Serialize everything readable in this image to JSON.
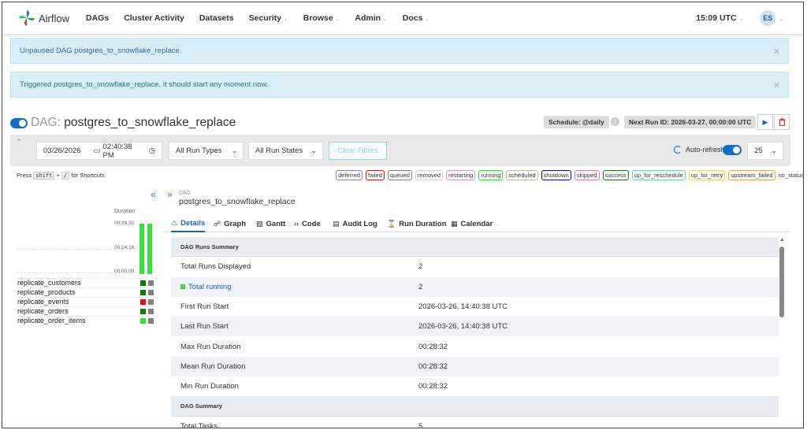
{
  "nav": {
    "brand": "Airflow",
    "items": [
      {
        "label": "DAGs",
        "caret": false
      },
      {
        "label": "Cluster Activity",
        "caret": false
      },
      {
        "label": "Datasets",
        "caret": false
      },
      {
        "label": "Security",
        "caret": true
      },
      {
        "label": "Browse",
        "caret": true
      },
      {
        "label": "Admin",
        "caret": true
      },
      {
        "label": "Docs",
        "caret": true
      }
    ],
    "time": "15:09 UTC",
    "user_initials": "ES"
  },
  "alerts": [
    "Unpaused DAG postgres_to_snowflake_replace.",
    "Triggered postgres_to_snowflake_replace, it should start any moment now."
  ],
  "dag": {
    "prefix": "DAG:",
    "id": "postgres_to_snowflake_replace",
    "schedule": "Schedule: @daily",
    "next_run": "Next Run ID: 2026-03-27, 00:00:00 UTC",
    "breadcrumb": "DAG"
  },
  "filters": {
    "date": "03/26/2026",
    "time": "02:40:38 PM",
    "run_types": "All Run Types",
    "run_states": "All Run States",
    "clear": "Clear Filters",
    "autorefresh": "Auto-refresh",
    "page_size": "25"
  },
  "shortcuts": {
    "prefix": "Press",
    "key1": "shift",
    "plus": "+",
    "key2": "/",
    "suffix": "for Shortcuts"
  },
  "legend": [
    {
      "label": "deferred",
      "color": "#9370db"
    },
    {
      "label": "failed",
      "color": "#ff0000"
    },
    {
      "label": "queued",
      "color": "#808080"
    },
    {
      "label": "removed",
      "color": "#d3d3d3"
    },
    {
      "label": "restarting",
      "color": "#ee82ee"
    },
    {
      "label": "running",
      "color": "#00ff00"
    },
    {
      "label": "scheduled",
      "color": "#d2b48c"
    },
    {
      "label": "shutdown",
      "color": "#0000ff"
    },
    {
      "label": "skipped",
      "color": "#ff69b4"
    },
    {
      "label": "success",
      "color": "#008000"
    },
    {
      "label": "up_for_reschedule",
      "color": "#40e0d0"
    },
    {
      "label": "up_for_retry",
      "color": "#ffd700"
    },
    {
      "label": "upstream_failed",
      "color": "#ffa500"
    },
    {
      "label": "no_status",
      "color": ""
    }
  ],
  "grid": {
    "duration_label": "Duration",
    "ticks": [
      "00:28:32",
      "00:14:16",
      "00:00:00"
    ],
    "tasks": [
      {
        "name": "replicate_customers",
        "states": [
          "#0a7a0a",
          "#808080"
        ]
      },
      {
        "name": "replicate_products",
        "states": [
          "#0a7a0a",
          "#808080"
        ]
      },
      {
        "name": "replicate_events",
        "states": [
          "#e01010",
          "#808080"
        ]
      },
      {
        "name": "replicate_orders",
        "states": [
          "#0a7a0a",
          "#808080"
        ]
      },
      {
        "name": "replicate_order_items",
        "states": [
          "#34e23a",
          "#808080"
        ]
      }
    ]
  },
  "tabs": [
    {
      "label": "Details",
      "icon": "⚠"
    },
    {
      "label": "Graph",
      "icon": "☍"
    },
    {
      "label": "Gantt",
      "icon": "▧"
    },
    {
      "label": "Code",
      "icon": "‹›"
    },
    {
      "label": "Audit Log",
      "icon": "▤"
    },
    {
      "label": "Run Duration",
      "icon": "⌛"
    },
    {
      "label": "Calendar",
      "icon": "▦"
    }
  ],
  "summary": {
    "runs_header": "DAG Runs Summary",
    "rows": [
      {
        "label": "Total Runs Displayed",
        "value": "2"
      },
      {
        "label": "Total running",
        "value": "2"
      },
      {
        "label": "First Run Start",
        "value": "2026-03-26, 14:40:38 UTC"
      },
      {
        "label": "Last Run Start",
        "value": "2026-03-26, 14:40:38 UTC"
      },
      {
        "label": "Max Run Duration",
        "value": "00:28:32"
      },
      {
        "label": "Mean Run Duration",
        "value": "00:28:32"
      },
      {
        "label": "Min Run Duration",
        "value": "00:28:32"
      }
    ],
    "dag_header": "DAG Summary",
    "dag_rows": [
      {
        "label": "Total Tasks",
        "value": "5"
      }
    ]
  }
}
